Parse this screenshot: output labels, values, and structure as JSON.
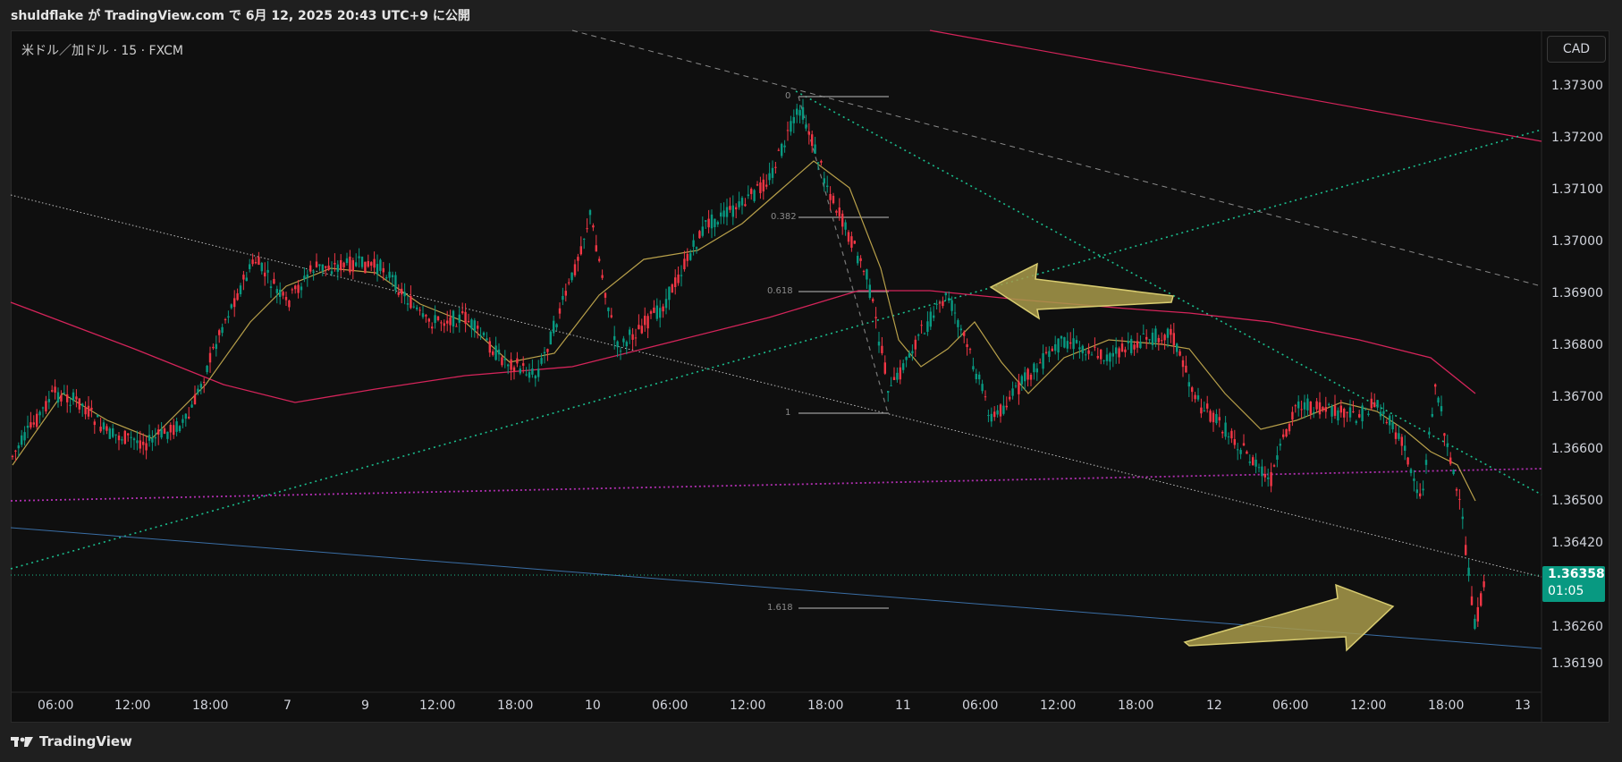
{
  "header": {
    "publish_line": "shuldflake が TradingView.com で 6月 12, 2025 20:43 UTC+9 に公開"
  },
  "chart": {
    "symbol_line": "米ドル／加ドル · 15 · FXCM",
    "currency_button": "CAD",
    "current_price": "1.36358",
    "countdown": "01:05",
    "price_axis": [
      "1.37300",
      "1.37200",
      "1.37100",
      "1.37000",
      "1.36900",
      "1.36800",
      "1.36700",
      "1.36600",
      "1.36500",
      "1.36420",
      "1.36260",
      "1.36190"
    ],
    "time_axis": [
      "06:00",
      "12:00",
      "18:00",
      "7",
      "9",
      "12:00",
      "18:00",
      "10",
      "06:00",
      "12:00",
      "18:00",
      "11",
      "06:00",
      "12:00",
      "18:00",
      "12",
      "06:00",
      "12:00",
      "18:00",
      "13"
    ],
    "fib_levels": [
      "0",
      "0.382",
      "0.618",
      "1",
      "1.618"
    ]
  },
  "footer": {
    "brand": "TradingView"
  },
  "colors": {
    "up": "#089981",
    "down": "#f23645",
    "ma_fast": "#b8a04a",
    "ma_slow": "#d4245a",
    "green_dotted": "#1bbf8f",
    "purple_dotted": "#b02fb0",
    "arrow": "#a89a4a"
  }
}
